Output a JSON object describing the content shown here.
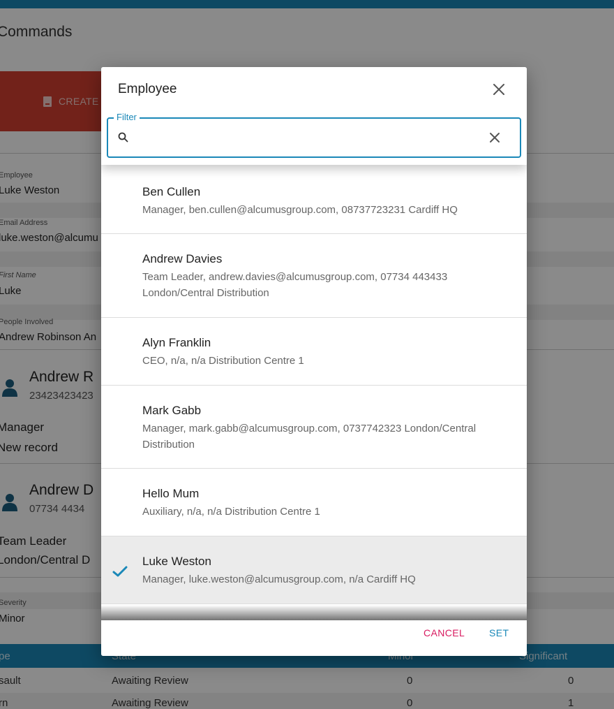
{
  "background": {
    "page_title": "Commands",
    "create_label": "CREATE",
    "fields": {
      "employee_label": "Employee",
      "employee_value": "Luke Weston",
      "email_label": "Email Address",
      "email_value": "luke.weston@alcumu",
      "first_name_label": "First Name",
      "first_name_value": "Luke",
      "people_label": "People Involved",
      "people_value": "Andrew Robinson  An",
      "severity_label": "Severity",
      "severity_value": "Minor"
    },
    "people": [
      {
        "name": "Andrew R",
        "phone": "23423423423",
        "role": "Manager",
        "note": "New record"
      },
      {
        "name": "Andrew D",
        "phone": "07734 4434",
        "role": "Team Leader",
        "note": "London/Central D"
      }
    ],
    "table": {
      "headers": [
        "pe",
        "State",
        "Minor",
        "Significant"
      ],
      "rows": [
        [
          "sault",
          "Awaiting Review",
          "0",
          "0"
        ],
        [
          "rn",
          "Awaiting Review",
          "0",
          "1"
        ]
      ]
    }
  },
  "dialog": {
    "title": "Employee",
    "filter_label": "Filter",
    "filter_value": "",
    "items": [
      {
        "name": "Ben Cullen",
        "desc": "Manager, ben.cullen@alcumusgroup.com, 08737723231 Cardiff HQ",
        "selected": false
      },
      {
        "name": "Andrew Davies",
        "desc": "Team Leader, andrew.davies@alcumusgroup.com, 07734 443433 London/Central Distribution",
        "selected": false
      },
      {
        "name": "Alyn Franklin",
        "desc": "CEO, n/a, n/a Distribution Centre 1",
        "selected": false
      },
      {
        "name": "Mark Gabb",
        "desc": "Manager, mark.gabb@alcumusgroup.com, 0737742323 London/Central Distribution",
        "selected": false
      },
      {
        "name": "Hello Mum",
        "desc": "Auxiliary, n/a, n/a Distribution Centre 1",
        "selected": false
      },
      {
        "name": "Luke Weston",
        "desc": "Manager, luke.weston@alcumusgroup.com, n/a Cardiff HQ",
        "selected": true
      }
    ],
    "cancel_label": "CANCEL",
    "set_label": "SET"
  },
  "colors": {
    "accent": "#1a88b8",
    "danger": "#d23f31",
    "cancel": "#d81b60"
  },
  "icons": {
    "close": "close-icon",
    "search": "search-icon",
    "clear": "clear-icon",
    "check": "check-icon",
    "person": "person-icon"
  }
}
